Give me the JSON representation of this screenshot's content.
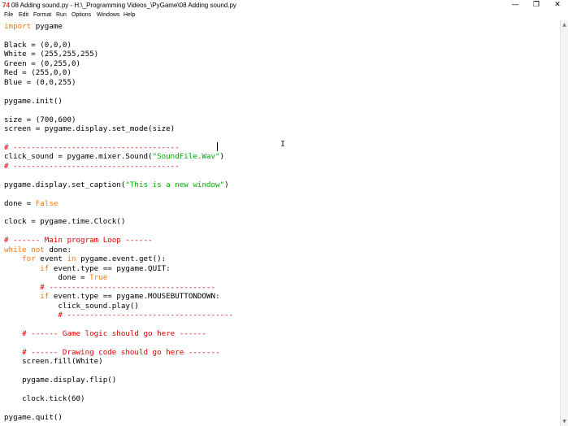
{
  "window": {
    "app_icon": "74",
    "title": "08 Adding sound.py - H:\\_Programming Videos_\\PyGame\\08 Adding sound.py",
    "minimize": "—",
    "maximize": "❐",
    "close": "✕"
  },
  "menu": [
    "File",
    "Edit",
    "Format",
    "Run",
    "Options",
    "Windows",
    "Help"
  ],
  "colors": {
    "keyword": "#ff7700",
    "string": "#00aa00",
    "comment": "#dd0000",
    "text": "#000000"
  },
  "code": [
    [
      [
        "import",
        "kw"
      ],
      [
        " pygame",
        ""
      ]
    ],
    [],
    [
      [
        "Black = (0,0,0)",
        ""
      ]
    ],
    [
      [
        "White = (255,255,255)",
        ""
      ]
    ],
    [
      [
        "Green = (0,255,0)",
        ""
      ]
    ],
    [
      [
        "Red = (255,0,0)",
        ""
      ]
    ],
    [
      [
        "Blue = (0,0,255)",
        ""
      ]
    ],
    [],
    [
      [
        "pygame.init()",
        ""
      ]
    ],
    [],
    [
      [
        "size = (700,600)",
        ""
      ]
    ],
    [
      [
        "screen = pygame.display.set_mode(size)",
        ""
      ]
    ],
    [],
    [
      [
        "# -------------------------------------",
        "cm"
      ]
    ],
    [
      [
        "click_sound = pygame.mixer.Sound(",
        ""
      ],
      [
        "\"SoundFile.Wav\"",
        "st"
      ],
      [
        ")",
        ""
      ]
    ],
    [
      [
        "# -------------------------------------",
        "cm"
      ]
    ],
    [],
    [
      [
        "pygame.display.set_caption(",
        ""
      ],
      [
        "\"This is a new window\"",
        "st"
      ],
      [
        ")",
        ""
      ]
    ],
    [],
    [
      [
        "done = ",
        ""
      ],
      [
        "False",
        "kw"
      ]
    ],
    [],
    [
      [
        "clock = pygame.time.Clock()",
        ""
      ]
    ],
    [],
    [
      [
        "# ------ Main program Loop ------",
        "cm"
      ]
    ],
    [
      [
        "while",
        "kw"
      ],
      [
        " ",
        ""
      ],
      [
        "not",
        "kw"
      ],
      [
        " done:",
        ""
      ]
    ],
    [
      [
        "    ",
        ""
      ],
      [
        "for",
        "kw"
      ],
      [
        " event ",
        ""
      ],
      [
        "in",
        "kw"
      ],
      [
        " pygame.event.get():",
        ""
      ]
    ],
    [
      [
        "        ",
        ""
      ],
      [
        "if",
        "kw"
      ],
      [
        " event.type == pygame.QUIT:",
        ""
      ]
    ],
    [
      [
        "            done = ",
        ""
      ],
      [
        "True",
        "kw"
      ]
    ],
    [
      [
        "        ",
        ""
      ],
      [
        "# -------------------------------------",
        "cm"
      ]
    ],
    [
      [
        "        ",
        ""
      ],
      [
        "if",
        "kw"
      ],
      [
        " event.type == pygame.MOUSEBUTTONDOWN:",
        ""
      ]
    ],
    [
      [
        "            click_sound.play()",
        ""
      ]
    ],
    [
      [
        "            ",
        ""
      ],
      [
        "# -------------------------------------",
        "cm"
      ]
    ],
    [],
    [
      [
        "    ",
        ""
      ],
      [
        "# ------ Game logic should go here ------",
        "cm"
      ]
    ],
    [],
    [
      [
        "    ",
        ""
      ],
      [
        "# ------ Drawing code should go here -------",
        "cm"
      ]
    ],
    [
      [
        "    screen.fill(White)",
        ""
      ]
    ],
    [],
    [
      [
        "    pygame.display.flip()",
        ""
      ]
    ],
    [],
    [
      [
        "    clock.tick(60)",
        ""
      ]
    ],
    [],
    [
      [
        "pygame.quit()",
        ""
      ]
    ]
  ]
}
